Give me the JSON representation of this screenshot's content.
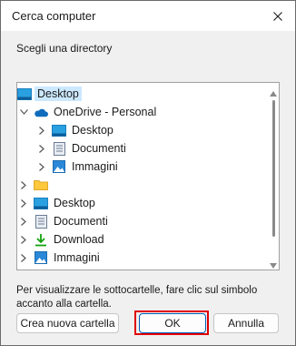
{
  "window": {
    "title": "Cerca computer"
  },
  "prompt": "Scegli una directory",
  "tree": {
    "items": [
      {
        "label": "Desktop",
        "icon": "desktop-folder-icon",
        "expander": "none",
        "selected": true
      },
      {
        "label": "OneDrive - Personal",
        "icon": "onedrive-cloud-icon",
        "expander": "expanded"
      },
      {
        "label": "Desktop",
        "icon": "desktop-folder-icon",
        "expander": "collapsed"
      },
      {
        "label": "Documenti",
        "icon": "documents-icon",
        "expander": "collapsed"
      },
      {
        "label": "Immagini",
        "icon": "pictures-icon",
        "expander": "collapsed"
      },
      {
        "label": "",
        "icon": "folder-icon",
        "expander": "collapsed"
      },
      {
        "label": "Desktop",
        "icon": "desktop-folder-icon",
        "expander": "collapsed"
      },
      {
        "label": "Documenti",
        "icon": "documents-icon",
        "expander": "collapsed"
      },
      {
        "label": "Download",
        "icon": "download-icon",
        "expander": "collapsed"
      },
      {
        "label": "Immagini",
        "icon": "pictures-icon",
        "expander": "collapsed"
      }
    ]
  },
  "hint": "Per visualizzare le sottocartelle, fare clic sul simbolo accanto alla cartella.",
  "buttons": {
    "new_folder": "Crea nuova cartella",
    "ok": "OK",
    "cancel": "Annulla"
  },
  "colors": {
    "selection": "#cce8ff",
    "highlight": "#e00000",
    "accent": "#005fb8"
  }
}
